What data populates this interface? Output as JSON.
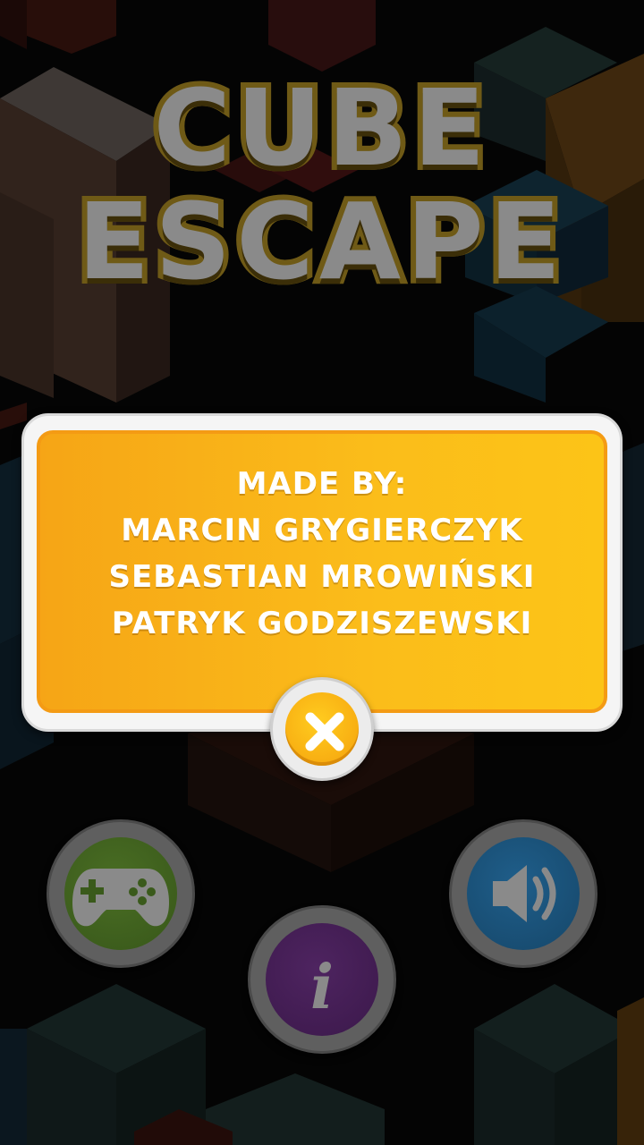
{
  "title": {
    "line1": "CUBE",
    "line2": "ESCAPE"
  },
  "credits": {
    "heading": "MADE BY:",
    "names": [
      "MARCIN GRYGIERCZYK",
      "SEBASTIAN MROWIŃSKI",
      "PATRYK GODZISZEWSKI"
    ]
  },
  "buttons": {
    "close": {
      "icon": "close-icon"
    },
    "games": {
      "icon": "gamepad-icon"
    },
    "info": {
      "icon": "info-icon",
      "glyph": "i"
    },
    "sound": {
      "icon": "speaker-icon"
    }
  },
  "colors": {
    "popup_yellow": "#fbbd1a",
    "popup_border": "#f49b14",
    "title_gray": "#8a8a8a",
    "games_green": "#3a5a1b",
    "sound_blue": "#174a6e",
    "info_purple": "#3e1a4e"
  }
}
